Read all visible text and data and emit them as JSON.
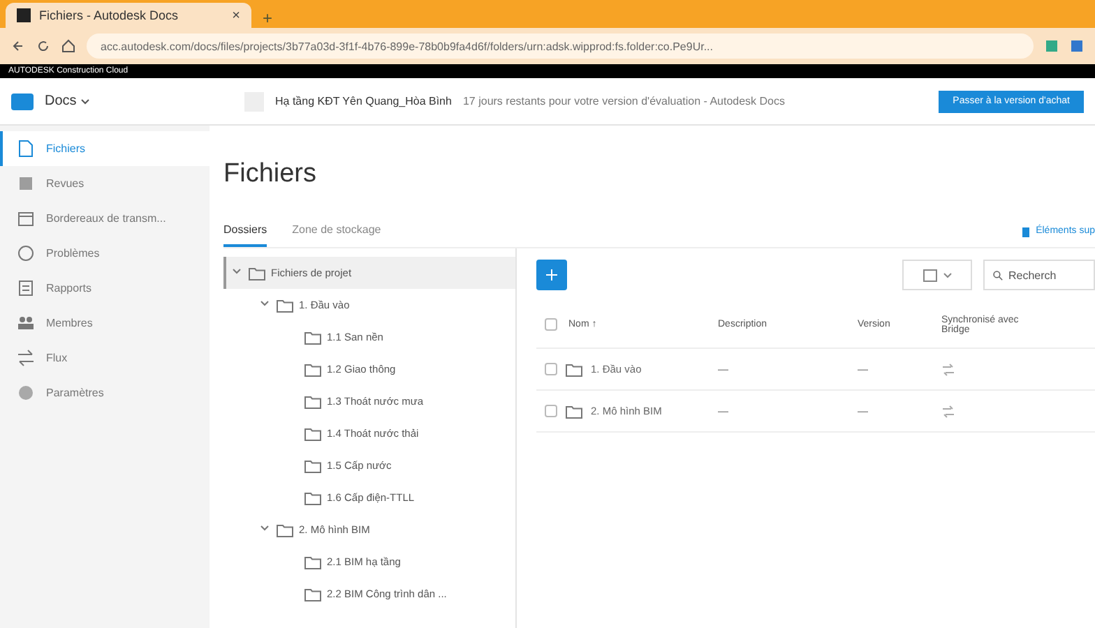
{
  "browser": {
    "tab_title": "Fichiers - Autodesk Docs",
    "tab_close": "×",
    "new_tab": "+",
    "url": "acc.autodesk.com/docs/files/projects/3b77a03d-3f1f-4b76-899e-78b0b9fa4d6f/folders/urn:adsk.wipprod:fs.folder:co.Pe9Ur..."
  },
  "brand_bar": {
    "text": "AUTODESK Construction Cloud"
  },
  "header": {
    "module": "Docs",
    "project": "Hạ tầng KĐT Yên Quang_Hòa Bình",
    "trial_notice": "17 jours restants pour votre version d'évaluation - Autodesk Docs",
    "upgrade_button": "Passer à la version d'achat"
  },
  "sidebar": {
    "items": [
      {
        "label": "Fichiers",
        "kind": "file",
        "selected": true
      },
      {
        "label": "Revues",
        "kind": "review",
        "selected": false
      },
      {
        "label": "Bordereaux de transm...",
        "kind": "calendar",
        "selected": false
      },
      {
        "label": "Problèmes",
        "kind": "issue",
        "selected": false
      },
      {
        "label": "Rapports",
        "kind": "report",
        "selected": false
      },
      {
        "label": "Membres",
        "kind": "members",
        "selected": false
      },
      {
        "label": "Flux",
        "kind": "flow",
        "selected": false
      },
      {
        "label": "Paramètres",
        "kind": "gear",
        "selected": false
      }
    ]
  },
  "page": {
    "title": "Fichiers",
    "tabs": [
      {
        "label": "Dossiers",
        "selected": true
      },
      {
        "label": "Zone de stockage",
        "selected": false
      }
    ],
    "deleted_link": "Éléments sup"
  },
  "tree": [
    {
      "label": "Fichiers de projet",
      "expanded": true,
      "selected": true,
      "children": [
        {
          "label": "1. Đầu vào",
          "expanded": true,
          "selected": false,
          "children": [
            {
              "label": "1.1 San nền",
              "selected": false
            },
            {
              "label": "1.2 Giao thông",
              "selected": false
            },
            {
              "label": "1.3 Thoát nước mưa",
              "selected": false
            },
            {
              "label": "1.4 Thoát nước thải",
              "selected": false
            },
            {
              "label": "1.5 Cấp nước",
              "selected": false
            },
            {
              "label": "1.6 Cấp điện-TTLL",
              "selected": false
            }
          ]
        },
        {
          "label": "2. Mô hình BIM",
          "expanded": true,
          "selected": false,
          "children": [
            {
              "label": "2.1 BIM hạ tầng",
              "selected": false
            },
            {
              "label": "2.2 BIM Công trình dân ...",
              "selected": false
            }
          ]
        }
      ]
    }
  ],
  "table": {
    "select_all_checked": false,
    "search_placeholder": "Recherch",
    "columns": [
      "Nom ↑",
      "Description",
      "Version",
      "Synchronisé avec Bridge"
    ],
    "rows": [
      {
        "name": "1. Đầu vào",
        "description": "—",
        "version": "—",
        "checked": false
      },
      {
        "name": "2. Mô hình BIM",
        "description": "—",
        "version": "—",
        "checked": false
      }
    ]
  }
}
